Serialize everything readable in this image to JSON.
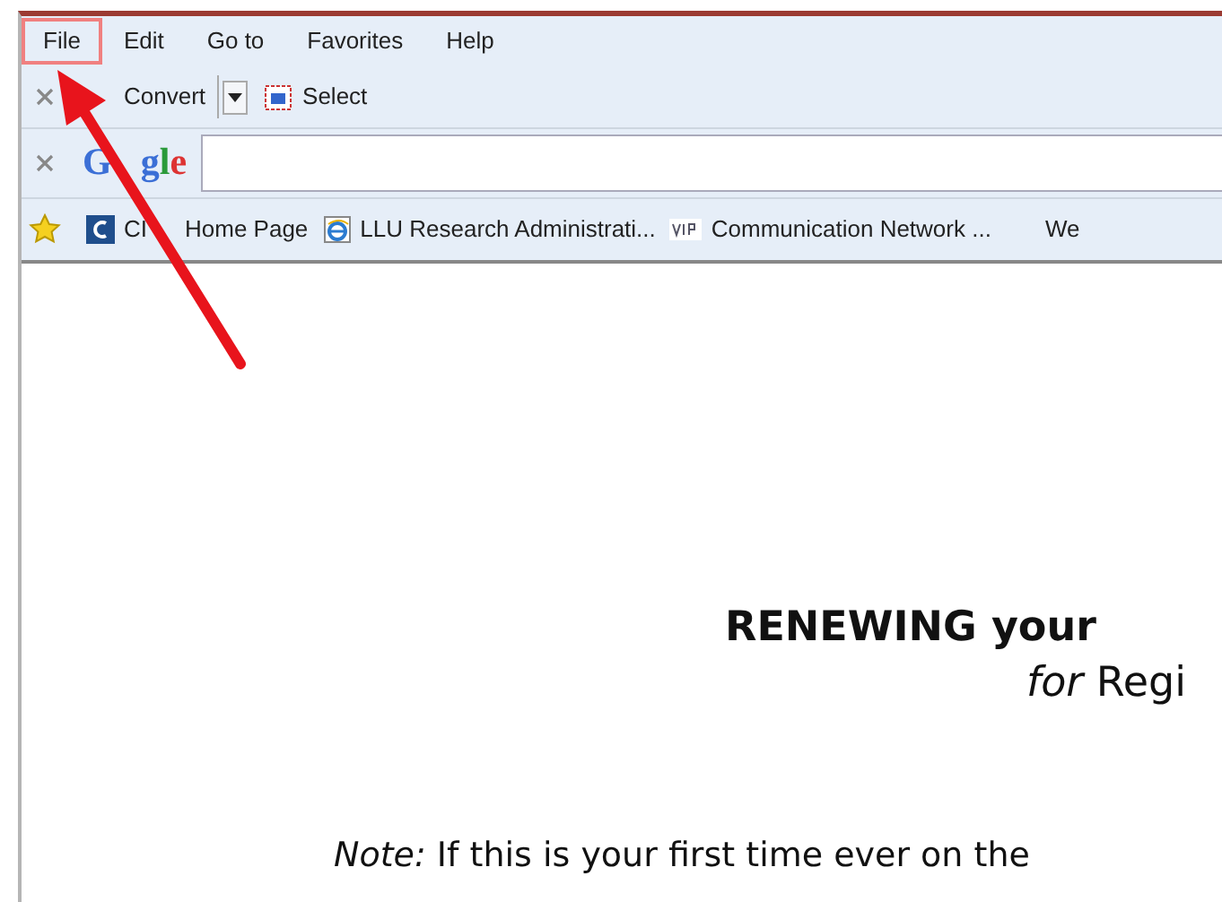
{
  "menu": [
    {
      "label": "File",
      "highlighted": true
    },
    {
      "label": "Edit",
      "highlighted": false
    },
    {
      "label": "Go to",
      "highlighted": false
    },
    {
      "label": "Favorites",
      "highlighted": false
    },
    {
      "label": "Help",
      "highlighted": false
    }
  ],
  "toolbar": [
    {
      "label": "Convert",
      "kind": "split"
    },
    {
      "label": "Select",
      "kind": "plain"
    }
  ],
  "search": {
    "logo_parts": [
      "G",
      "gle"
    ]
  },
  "bookmarks": [
    {
      "label_parts": [
        "CI",
        "Home Page"
      ],
      "kind": "c"
    },
    {
      "label_parts": [
        "LLU Research Administrati..."
      ],
      "kind": "ie"
    },
    {
      "label_parts": [
        "Communication Network ..."
      ],
      "kind": "vip"
    },
    {
      "label_parts": [
        "We"
      ],
      "kind": "none"
    }
  ],
  "document": {
    "title": "RENEWING your",
    "subtitle": "*for* Regi",
    "note": "*Note:* If this is your first time ever on the"
  }
}
